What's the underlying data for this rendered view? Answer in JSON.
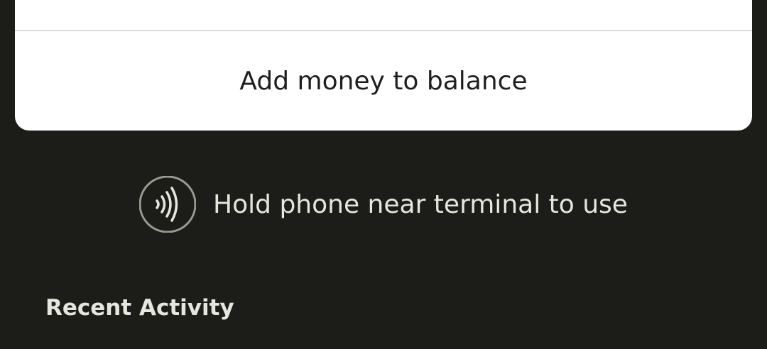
{
  "balance_card": {
    "add_money_label": "Add money to balance"
  },
  "nfc": {
    "icon": "contactless-icon",
    "instruction": "Hold phone near terminal to use"
  },
  "recent_activity": {
    "heading": "Recent Activity"
  },
  "colors": {
    "background": "#1c1c18",
    "card": "#ffffff",
    "text_light": "#e6e6e0",
    "text_dark": "#1f1f1f"
  }
}
